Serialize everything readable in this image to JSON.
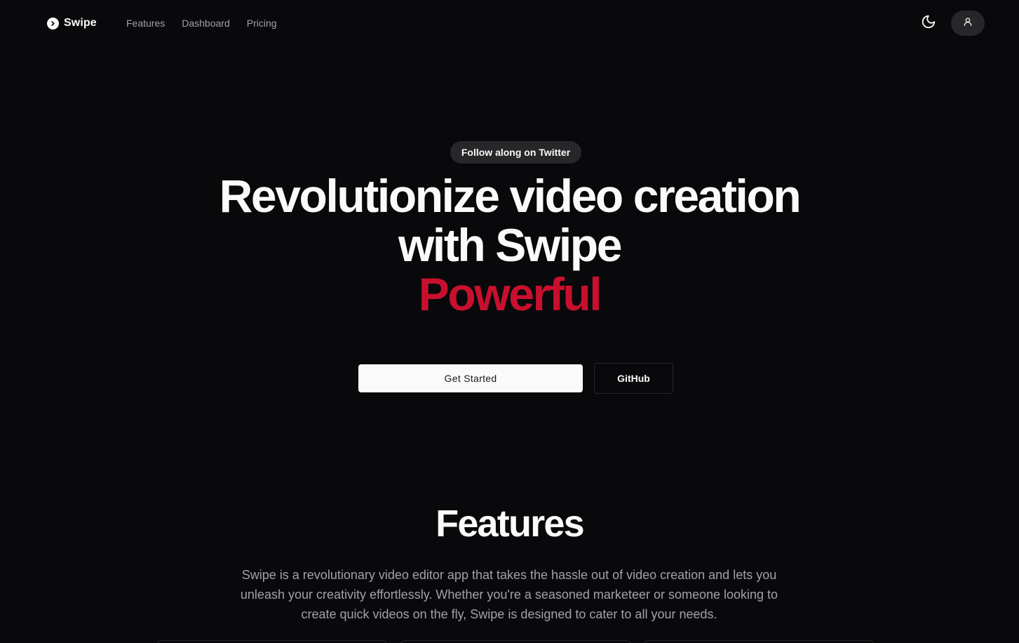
{
  "header": {
    "brand_name": "Swipe",
    "nav": [
      {
        "label": "Features"
      },
      {
        "label": "Dashboard"
      },
      {
        "label": "Pricing"
      }
    ]
  },
  "hero": {
    "pill_label": "Follow along on Twitter",
    "headline_line1": "Revolutionize video creation",
    "headline_line2": "with Swipe",
    "headline_accent": "Powerful",
    "primary_cta": "Get Started",
    "secondary_cta": "GitHub"
  },
  "features": {
    "title": "Features",
    "description": "Swipe is a revolutionary video editor app that takes the hassle out of video creation and lets you unleash your creativity effortlessly. Whether you're a seasoned marketeer or someone looking to create quick videos on the fly, Swipe is designed to cater to all your needs."
  },
  "colors": {
    "background": "#09090b",
    "foreground": "#fafafa",
    "muted": "#a1a1aa",
    "accent": "#c8102e",
    "secondary_bg": "#27272a"
  },
  "icons": {
    "brand": "chevron-right-circle-icon",
    "theme": "moon-icon",
    "user": "user-icon"
  }
}
